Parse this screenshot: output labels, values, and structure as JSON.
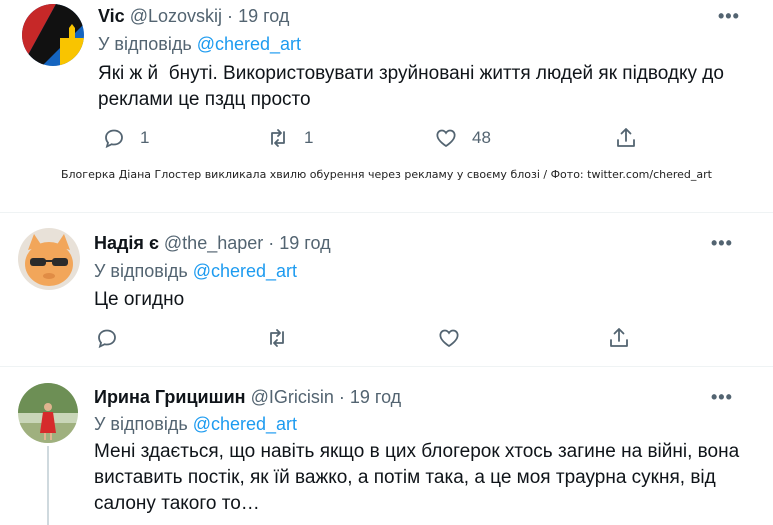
{
  "tweets": [
    {
      "name": "Vic",
      "handle": "@Lozovskij",
      "separator": "·",
      "time": "19 год",
      "reply_prefix": "У відповідь",
      "reply_mention": "@chered_art",
      "text_line1": "Які ж й  бнуті. Використовувати зруйновані життя людей як підводку до",
      "text_line2": "реклами це пздц просто",
      "more": "•••",
      "reply_count": "1",
      "retweet_count": "1",
      "like_count": "48",
      "avatar_colors": [
        "#c62828",
        "#1565c0",
        "#f9c400",
        "#111111"
      ]
    },
    {
      "name": "Надія є",
      "handle": "@the_haper",
      "separator": "·",
      "time": "19 год",
      "reply_prefix": "У відповідь",
      "reply_mention": "@chered_art",
      "text_line1": "Це огидно",
      "more": "•••",
      "avatar_colors": [
        "#f2a65a",
        "#2b2b2b",
        "#e8e1d8"
      ]
    },
    {
      "name": "Ирина Грицишин",
      "handle": "@IGricisin",
      "separator": "·",
      "time": "19 год",
      "reply_prefix": "У відповідь",
      "reply_mention": "@chered_art",
      "text_line1": "Мені здається, що навіть якщо в цих блогерок хтось загине на війні, вона",
      "text_line2": "виставить постік, як їй важко, а потім така, а це моя траурна сукня, від",
      "text_line3": "салону такого то…",
      "more": "•••",
      "avatar_colors": [
        "#6d8f55",
        "#d62b2b",
        "#c9d6b8"
      ]
    }
  ],
  "caption": "Блогерка Діана Глостер викликала хвилю обурення через рекламу у своєму блозі / Фото: twitter.com/chered_art",
  "colors": {
    "accent": "#1d9bf0",
    "secondary_text": "#536471",
    "primary_text": "#0f1419"
  }
}
